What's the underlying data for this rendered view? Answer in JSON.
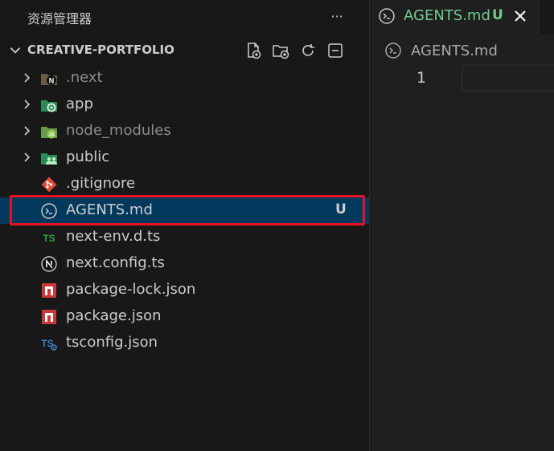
{
  "explorer": {
    "title": "资源管理器",
    "more_label": "···",
    "project_name": "CREATIVE-PORTFOLIO"
  },
  "tree": {
    "items": [
      {
        "label": ".next",
        "icon": "next-folder-icon",
        "type": "folder",
        "dim": true
      },
      {
        "label": "app",
        "icon": "app-folder-icon",
        "type": "folder",
        "dim": false
      },
      {
        "label": "node_modules",
        "icon": "node-modules-folder-icon",
        "type": "folder",
        "dim": true
      },
      {
        "label": "public",
        "icon": "public-folder-icon",
        "type": "folder",
        "dim": false
      },
      {
        "label": ".gitignore",
        "icon": "git-icon",
        "type": "file",
        "dim": false
      },
      {
        "label": "AGENTS.md",
        "icon": "terminal-icon",
        "type": "file",
        "dim": false,
        "selected": true,
        "badge": "U"
      },
      {
        "label": "next-env.d.ts",
        "icon": "typescript-icon",
        "type": "file",
        "dim": false
      },
      {
        "label": "next.config.ts",
        "icon": "nextjs-icon",
        "type": "file",
        "dim": false
      },
      {
        "label": "package-lock.json",
        "icon": "npm-icon",
        "type": "file",
        "dim": false
      },
      {
        "label": "package.json",
        "icon": "npm-icon",
        "type": "file",
        "dim": false
      },
      {
        "label": "tsconfig.json",
        "icon": "tsconfig-icon",
        "type": "file",
        "dim": false
      }
    ]
  },
  "editor": {
    "tab_label": "AGENTS.md",
    "tab_badge": "U",
    "breadcrumb": "AGENTS.md",
    "line_number": "1"
  },
  "colors": {
    "accent_selected": "#04395e",
    "highlight_border": "#e81123",
    "untracked_green": "#73c991"
  }
}
